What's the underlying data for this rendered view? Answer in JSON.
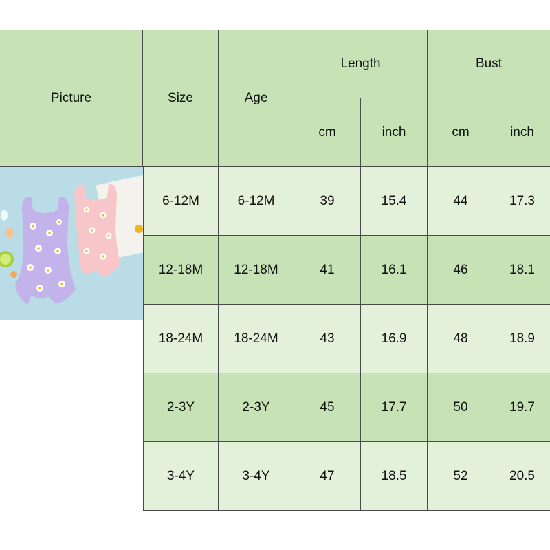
{
  "headers": {
    "picture": "Picture",
    "size": "Size",
    "age": "Age",
    "length": "Length",
    "bust": "Bust",
    "cm": "cm",
    "inch": "inch"
  },
  "rows": [
    {
      "size": "6-12M",
      "age": "6-12M",
      "length_cm": "39",
      "length_inch": "15.4",
      "bust_cm": "44",
      "bust_inch": "17.3"
    },
    {
      "size": "12-18M",
      "age": "12-18M",
      "length_cm": "41",
      "length_inch": "16.1",
      "bust_cm": "46",
      "bust_inch": "18.1"
    },
    {
      "size": "18-24M",
      "age": "18-24M",
      "length_cm": "43",
      "length_inch": "16.9",
      "bust_cm": "48",
      "bust_inch": "18.9"
    },
    {
      "size": "2-3Y",
      "age": "2-3Y",
      "length_cm": "45",
      "length_inch": "17.7",
      "bust_cm": "50",
      "bust_inch": "19.7"
    },
    {
      "size": "3-4Y",
      "age": "3-4Y",
      "length_cm": "47",
      "length_inch": "18.5",
      "bust_cm": "52",
      "bust_inch": "20.5"
    }
  ],
  "colors": {
    "header_green": "#c7e2b5",
    "dark_row_green": "#c7e2b5",
    "light_row_green": "#e4f1da",
    "border": "#4a4a4a"
  },
  "picture_icon": "swimsuit-photo"
}
